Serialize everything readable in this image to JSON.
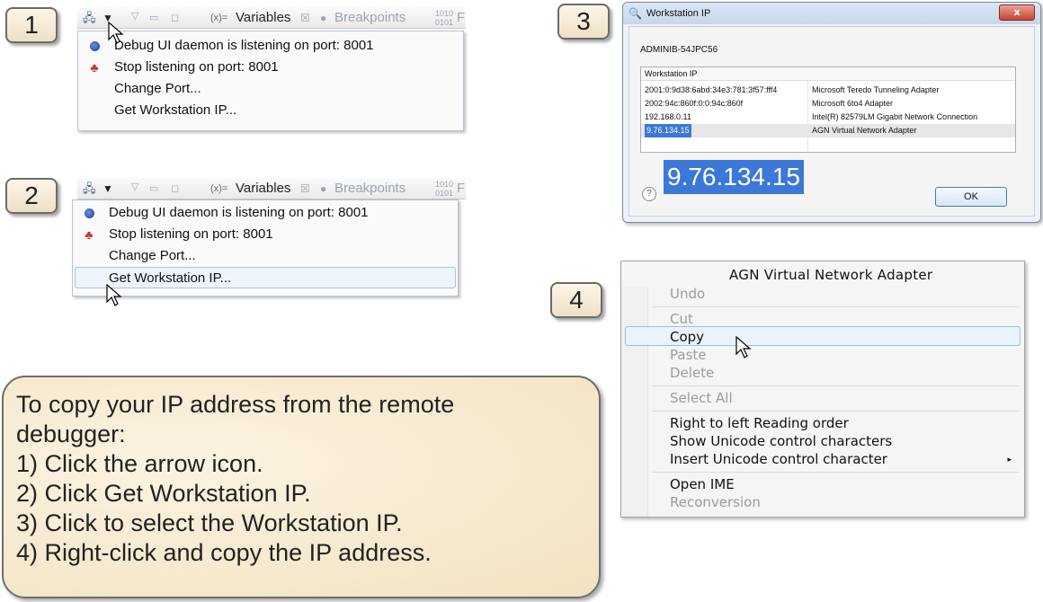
{
  "steps": [
    "1",
    "2",
    "3",
    "4"
  ],
  "panel1": {
    "tab_label": "Variables",
    "tab_close": "☒",
    "tab2_label": "Breakpoints",
    "tab3_label": "F",
    "menu": [
      {
        "label": "Debug UI daemon is listening on port: 8001",
        "icon": "radio-dot-icon"
      },
      {
        "label": "Stop listening on port: 8001",
        "icon": "stop-listening-icon"
      },
      {
        "label": "Change Port...",
        "icon": ""
      },
      {
        "label": "Get Workstation IP...",
        "icon": ""
      }
    ]
  },
  "panel2": {
    "tab_label": "Variables",
    "tab_close": "☒",
    "tab2_label": "Breakpoints",
    "tab3_label": "F",
    "menu": [
      {
        "label": "Debug UI daemon is listening on port: 8001",
        "icon": "radio-dot-icon"
      },
      {
        "label": "Stop listening on port: 8001",
        "icon": "stop-listening-icon"
      },
      {
        "label": "Change Port...",
        "icon": ""
      },
      {
        "label": "Get Workstation IP...",
        "icon": "",
        "highlighted": true
      }
    ]
  },
  "dialog": {
    "title": "Workstation IP",
    "close_label": "x",
    "hostname": "ADMINIB-54JPC56",
    "table_header": "Workstation IP",
    "rows": [
      {
        "ip": "2001:0:9d38:6abd:34e3:781:3f57:fff4",
        "adapter": "Microsoft Teredo Tunneling Adapter"
      },
      {
        "ip": "2002:94c:860f:0:0:94c:860f",
        "adapter": "Microsoft 6to4 Adapter"
      },
      {
        "ip": "192.168.0.11",
        "adapter": "Intel(R) 82579LM Gigabit Network Connection"
      },
      {
        "ip": "9.76.134.15",
        "adapter": "AGN Virtual Network Adapter",
        "selected": true
      }
    ],
    "selected_ip_large": "9.76.134.15",
    "help_label": "?",
    "ok_label": "OK"
  },
  "context_menu": {
    "header": "AGN Virtual Network Adapter",
    "items": [
      {
        "label": "Undo",
        "disabled": true
      },
      {
        "label": "Cut",
        "disabled": true
      },
      {
        "label": "Copy",
        "disabled": false,
        "highlighted": true
      },
      {
        "label": "Paste",
        "disabled": true
      },
      {
        "label": "Delete",
        "disabled": true
      },
      {
        "label": "Select All",
        "disabled": true
      },
      {
        "label": "Right to left Reading order",
        "disabled": false
      },
      {
        "label": "Show Unicode control characters",
        "disabled": false
      },
      {
        "label": "Insert Unicode control character",
        "disabled": false,
        "submenu": true
      },
      {
        "label": "Open IME",
        "disabled": false
      },
      {
        "label": "Reconversion",
        "disabled": true
      }
    ],
    "submenu_arrow": "▸"
  },
  "instructions": {
    "lines": [
      "To copy your IP address from the remote",
      "debugger:",
      "1)  Click the arrow icon.",
      "2)  Click Get Workstation IP.",
      "3)  Click to select the Workstation IP.",
      "4)  Right-click and copy the IP address."
    ]
  },
  "colors": {
    "selection_blue": "#3b78d8",
    "callout_bg": "#f5e7c9",
    "badge_border": "#6b6b6b"
  }
}
